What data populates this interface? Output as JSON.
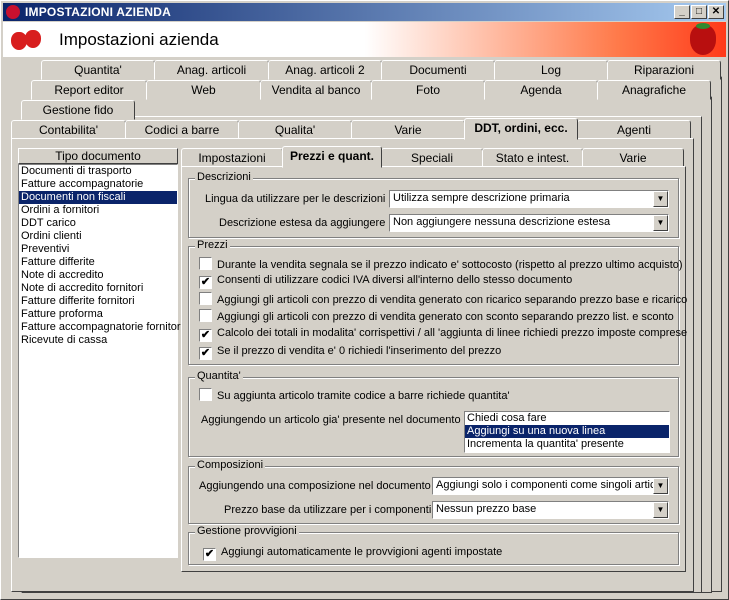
{
  "window": {
    "title": "IMPOSTAZIONI AZIENDA",
    "minimize": "_",
    "maximize": "□",
    "close": "✕"
  },
  "header": {
    "title": "Impostazioni azienda"
  },
  "tabs": {
    "row1": [
      "Quantita'",
      "Anag. articoli",
      "Anag. articoli 2",
      "Documenti",
      "Log",
      "Riparazioni"
    ],
    "row2": [
      "Report editor",
      "Web",
      "Vendita al banco",
      "Foto",
      "Agenda",
      "Anagrafiche"
    ],
    "row3": [
      "Gestione fido"
    ],
    "row4": [
      "Contabilita'",
      "Codici a barre",
      "Qualita'",
      "Varie",
      "DDT, ordini, ecc.",
      "Agenti"
    ],
    "active": "DDT, ordini, ecc."
  },
  "doc_list": {
    "header": "Tipo documento",
    "items": [
      "Documenti di trasporto",
      "Fatture accompagnatorie",
      "Documenti non fiscali",
      "Ordini a fornitori",
      "DDT carico",
      "Ordini clienti",
      "Preventivi",
      "Fatture differite",
      "Note di accredito",
      "Note di accredito fornitori",
      "Fatture differite fornitori",
      "Fatture proforma",
      "Fatture accompagnatorie fornitori",
      "Ricevute di cassa"
    ],
    "selected": "Documenti non fiscali"
  },
  "subtabs": {
    "items": [
      "Impostazioni",
      "Prezzi e quant.",
      "Speciali",
      "Stato e intest.",
      "Varie"
    ],
    "active": "Prezzi e quant."
  },
  "descrizioni": {
    "title": "Descrizioni",
    "lingua_label": "Lingua da utilizzare per le descrizioni :",
    "lingua_value": "Utilizza sempre descrizione primaria",
    "estesa_label": "Descrizione estesa da aggiungere :",
    "estesa_value": "Non aggiungere nessuna descrizione estesa"
  },
  "prezzi": {
    "title": "Prezzi",
    "options": [
      {
        "label": "Durante la vendita segnala se il prezzo indicato e' sottocosto (rispetto al prezzo ultimo acquisto)",
        "checked": false
      },
      {
        "label": "Consenti di utilizzare codici IVA diversi all'interno dello stesso documento",
        "checked": true
      },
      {
        "label": "Aggiungi gli articoli con prezzo di vendita generato con ricarico separando prezzo base e ricarico",
        "checked": false
      },
      {
        "label": "Aggiungi gli articoli con prezzo di vendita generato con sconto separando prezzo list. e sconto",
        "checked": false
      },
      {
        "label": "Calcolo dei totali in modalita' corrispettivi / all 'aggiunta di linee richiedi prezzo imposte comprese",
        "checked": true
      },
      {
        "label": "Se il prezzo di vendita e' 0 richiedi l'inserimento del prezzo",
        "checked": true
      }
    ]
  },
  "quantita": {
    "title": "Quantita'",
    "barcode_label": "Su aggiunta articolo tramite codice a barre richiede quantita'",
    "barcode_checked": false,
    "presente_label": "Aggiungendo un articolo gia' presente nel documento :",
    "presente_options": [
      "Chiedi cosa fare",
      "Aggiungi su una nuova linea",
      "Incrementa la quantita' presente"
    ],
    "presente_selected": "Aggiungi su una nuova linea"
  },
  "composizioni": {
    "title": "Composizioni",
    "aggiungendo_label": "Aggiungendo una composizione nel documento :",
    "aggiungendo_value": "Aggiungi solo i componenti come singoli artico",
    "prezzo_label": "Prezzo base da utilizzare per i componenti :",
    "prezzo_value": "Nessun prezzo base"
  },
  "provvigioni": {
    "title": "Gestione provvigioni",
    "auto_label": "Aggiungi automaticamente le provvigioni agenti impostate",
    "auto_checked": true
  },
  "check_mark": "✔",
  "combo_arrow": "▼",
  "colors": {
    "titlebar_start": "#0a246a",
    "titlebar_end": "#a6caf0",
    "selection": "#0a246a",
    "face": "#d4d0c8",
    "strawberry": "#d81e1e"
  }
}
